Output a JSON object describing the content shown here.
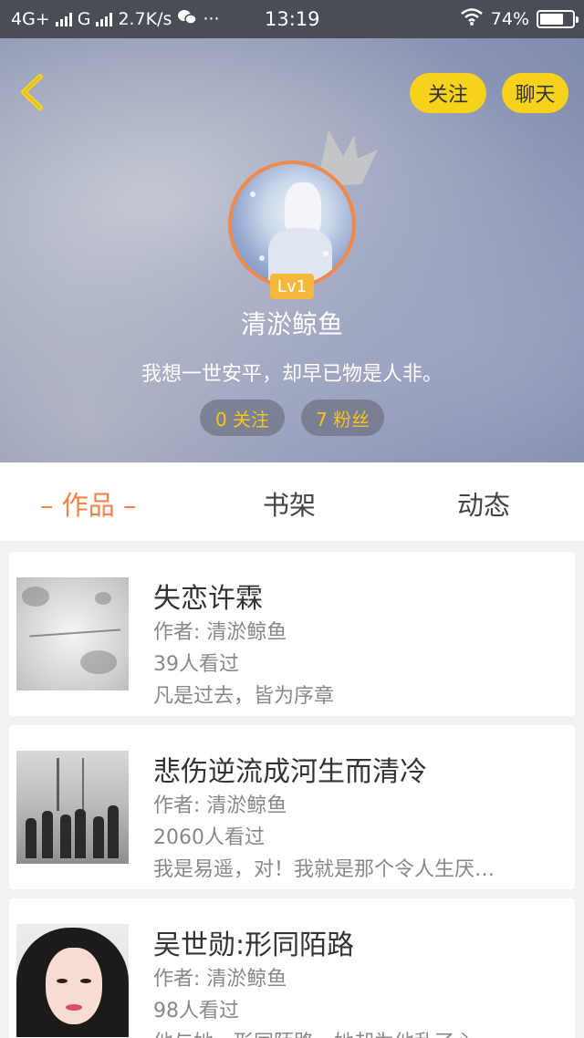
{
  "status_bar": {
    "network1": "4G+",
    "network2": "G",
    "speed": "2.7K/s",
    "more": "···",
    "time": "13:19",
    "battery_percent": "74%",
    "battery_level": 0.74,
    "icons": [
      "signal-icon",
      "wechat-icon",
      "wifi-icon",
      "battery-icon"
    ]
  },
  "header": {
    "back_icon": "chevron-left-icon",
    "follow_label": "关注",
    "chat_label": "聊天",
    "level": "Lv1",
    "username": "清淤鲸鱼",
    "signature": "我想一世安平，却早已物是人非。",
    "following": "0 关注",
    "fans": "7 粉丝",
    "accent_color": "#f7d21c",
    "avatar_ring_color": "#f08a4b"
  },
  "tabs": [
    {
      "label": "– 作品 –",
      "active": true
    },
    {
      "label": "书架",
      "active": false
    },
    {
      "label": "动态",
      "active": false
    }
  ],
  "works": [
    {
      "title": "失恋许霖",
      "author": "作者: 清淤鲸鱼",
      "views": "39人看过",
      "desc": "凡是过去，皆为序章"
    },
    {
      "title": "悲伤逆流成河生而清冷",
      "author": "作者: 清淤鲸鱼",
      "views": "2060人看过",
      "desc": "我是易遥，对！我就是那个令人生厌…"
    },
    {
      "title": "吴世勋:形同陌路",
      "author": "作者: 清淤鲸鱼",
      "views": "98人看过",
      "desc": "他与她，形同陌路，她却为他乱了心"
    }
  ]
}
